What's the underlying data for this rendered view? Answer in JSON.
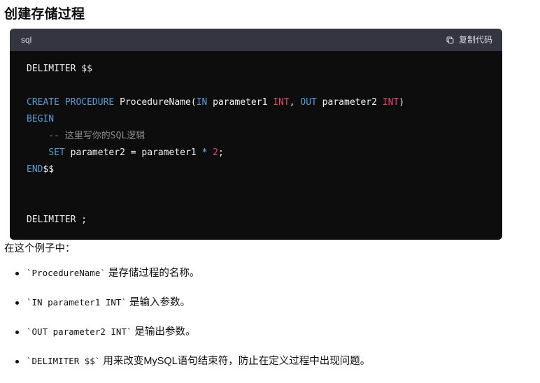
{
  "page": {
    "title": "创建存储过程",
    "background": "#ffffff",
    "text_color": "#111111"
  },
  "code_block": {
    "language_label": "sql",
    "copy_button_label": "复制代码",
    "copy_icon": "copy-icon",
    "header_bg": "#343541",
    "body_bg": "#0d0d0d",
    "lines": [
      {
        "id": 1,
        "tokens": [
          {
            "t": "DELIMITER $$",
            "c": "plain"
          }
        ]
      },
      {
        "id": 2,
        "tokens": []
      },
      {
        "id": 3,
        "tokens": [
          {
            "t": "CREATE",
            "c": "kw"
          },
          {
            "t": " ",
            "c": "plain"
          },
          {
            "t": "PROCEDURE",
            "c": "kw"
          },
          {
            "t": " ProcedureName(",
            "c": "plain"
          },
          {
            "t": "IN",
            "c": "kw"
          },
          {
            "t": " parameter1 ",
            "c": "plain"
          },
          {
            "t": "INT",
            "c": "type"
          },
          {
            "t": ", ",
            "c": "plain"
          },
          {
            "t": "OUT",
            "c": "kw"
          },
          {
            "t": " parameter2 ",
            "c": "plain"
          },
          {
            "t": "INT",
            "c": "type"
          },
          {
            "t": ")",
            "c": "plain"
          }
        ]
      },
      {
        "id": 4,
        "tokens": [
          {
            "t": "BEGIN",
            "c": "kw"
          }
        ]
      },
      {
        "id": 5,
        "tokens": [
          {
            "t": "    -- 这里写你的SQL逻辑",
            "c": "comment"
          }
        ]
      },
      {
        "id": 6,
        "tokens": [
          {
            "t": "    ",
            "c": "plain"
          },
          {
            "t": "SET",
            "c": "kw"
          },
          {
            "t": " parameter2 = parameter1 ",
            "c": "plain"
          },
          {
            "t": "*",
            "c": "op"
          },
          {
            "t": " ",
            "c": "plain"
          },
          {
            "t": "2",
            "c": "num"
          },
          {
            "t": ";",
            "c": "plain"
          }
        ]
      },
      {
        "id": 7,
        "tokens": [
          {
            "t": "END",
            "c": "kw"
          },
          {
            "t": "$$",
            "c": "plain"
          }
        ]
      },
      {
        "id": 8,
        "tokens": []
      },
      {
        "id": 9,
        "tokens": []
      },
      {
        "id": 10,
        "tokens": [
          {
            "t": "DELIMITER ;",
            "c": "plain"
          }
        ]
      }
    ],
    "colors": {
      "keyword": "#569cd6",
      "number": "#e4436f",
      "type": "#e4436f",
      "comment": "#8a8a8a",
      "operator": "#7fbde0",
      "plain": "#f2f2f2"
    }
  },
  "prose": {
    "intro": "在这个例子中：",
    "bullets": [
      {
        "code": "`ProcedureName`",
        "text": " 是存储过程的名称。"
      },
      {
        "code": "`IN parameter1 INT`",
        "text": " 是输入参数。"
      },
      {
        "code": "`OUT parameter2 INT`",
        "text": " 是输出参数。"
      },
      {
        "code": "`DELIMITER $$`",
        "text": " 用来改变MySQL语句结束符，防止在定义过程中出现问题。"
      }
    ]
  }
}
